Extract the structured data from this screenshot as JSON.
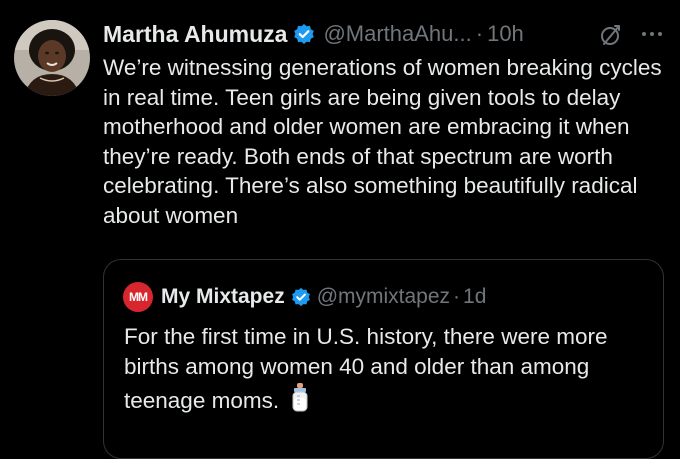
{
  "tweet": {
    "author": {
      "name": "Martha Ahumuza",
      "handle": "@MarthaAhu...",
      "verified": true,
      "avatar": "profile-photo"
    },
    "separator": "·",
    "time": "10h",
    "icons": [
      "grok-icon",
      "more-icon"
    ],
    "text": "We’re witnessing generations of women breaking cycles in real time. Teen girls are being given tools to delay motherhood and older women are embracing it when they’re ready. Both ends of that spectrum are worth celebrating. There’s also something beautifully radical about women"
  },
  "quote": {
    "author": {
      "name": "My Mixtapez",
      "handle": "@mymixtapez",
      "verified": true,
      "avatar_text": "MM"
    },
    "separator": "·",
    "time": "1d",
    "text": "For the first time in U.S. history, there were more births among women 40 and older than among teenage moms.",
    "emoji": "baby-bottle-icon"
  },
  "colors": {
    "background": "#000000",
    "primary_text": "#e7e9ea",
    "secondary_text": "#71767b",
    "verified": "#1d9bf0",
    "quote_border": "#2f3336",
    "mixtapez_brand": "#d8262e"
  }
}
